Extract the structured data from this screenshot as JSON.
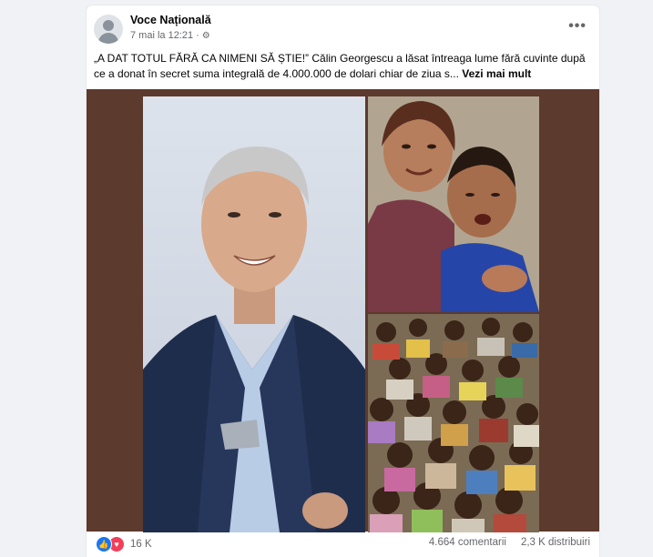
{
  "post": {
    "page_name": "Voce Națională",
    "timestamp": "7 mai la 12:21",
    "audience_icon": "gear-icon",
    "more_options": "•••",
    "caption_text": "„A DAT TOTUL FĂRĂ CA NIMENI SĂ ȘTIE!” Călin Georgescu a lăsat întreaga lume fără cuvinte după ce a donat în secret suma integrală de 4.000.000 de dolari chiar de ziua s...",
    "see_more": "Vezi mai mult"
  },
  "media": {
    "background_color": "#5c3a2d",
    "images": [
      "portrait-of-man-in-suit",
      "two-crying-children",
      "crowd-of-children"
    ]
  },
  "footer": {
    "reaction_icons": [
      "like-icon",
      "love-icon"
    ],
    "reaction_count": "16 K",
    "comments": "4.664 comentarii",
    "shares": "2,3 K distribuiri"
  },
  "colors": {
    "like": "#1877f2",
    "love": "#f33e58",
    "text": "#050505",
    "secondary": "#65676b"
  }
}
